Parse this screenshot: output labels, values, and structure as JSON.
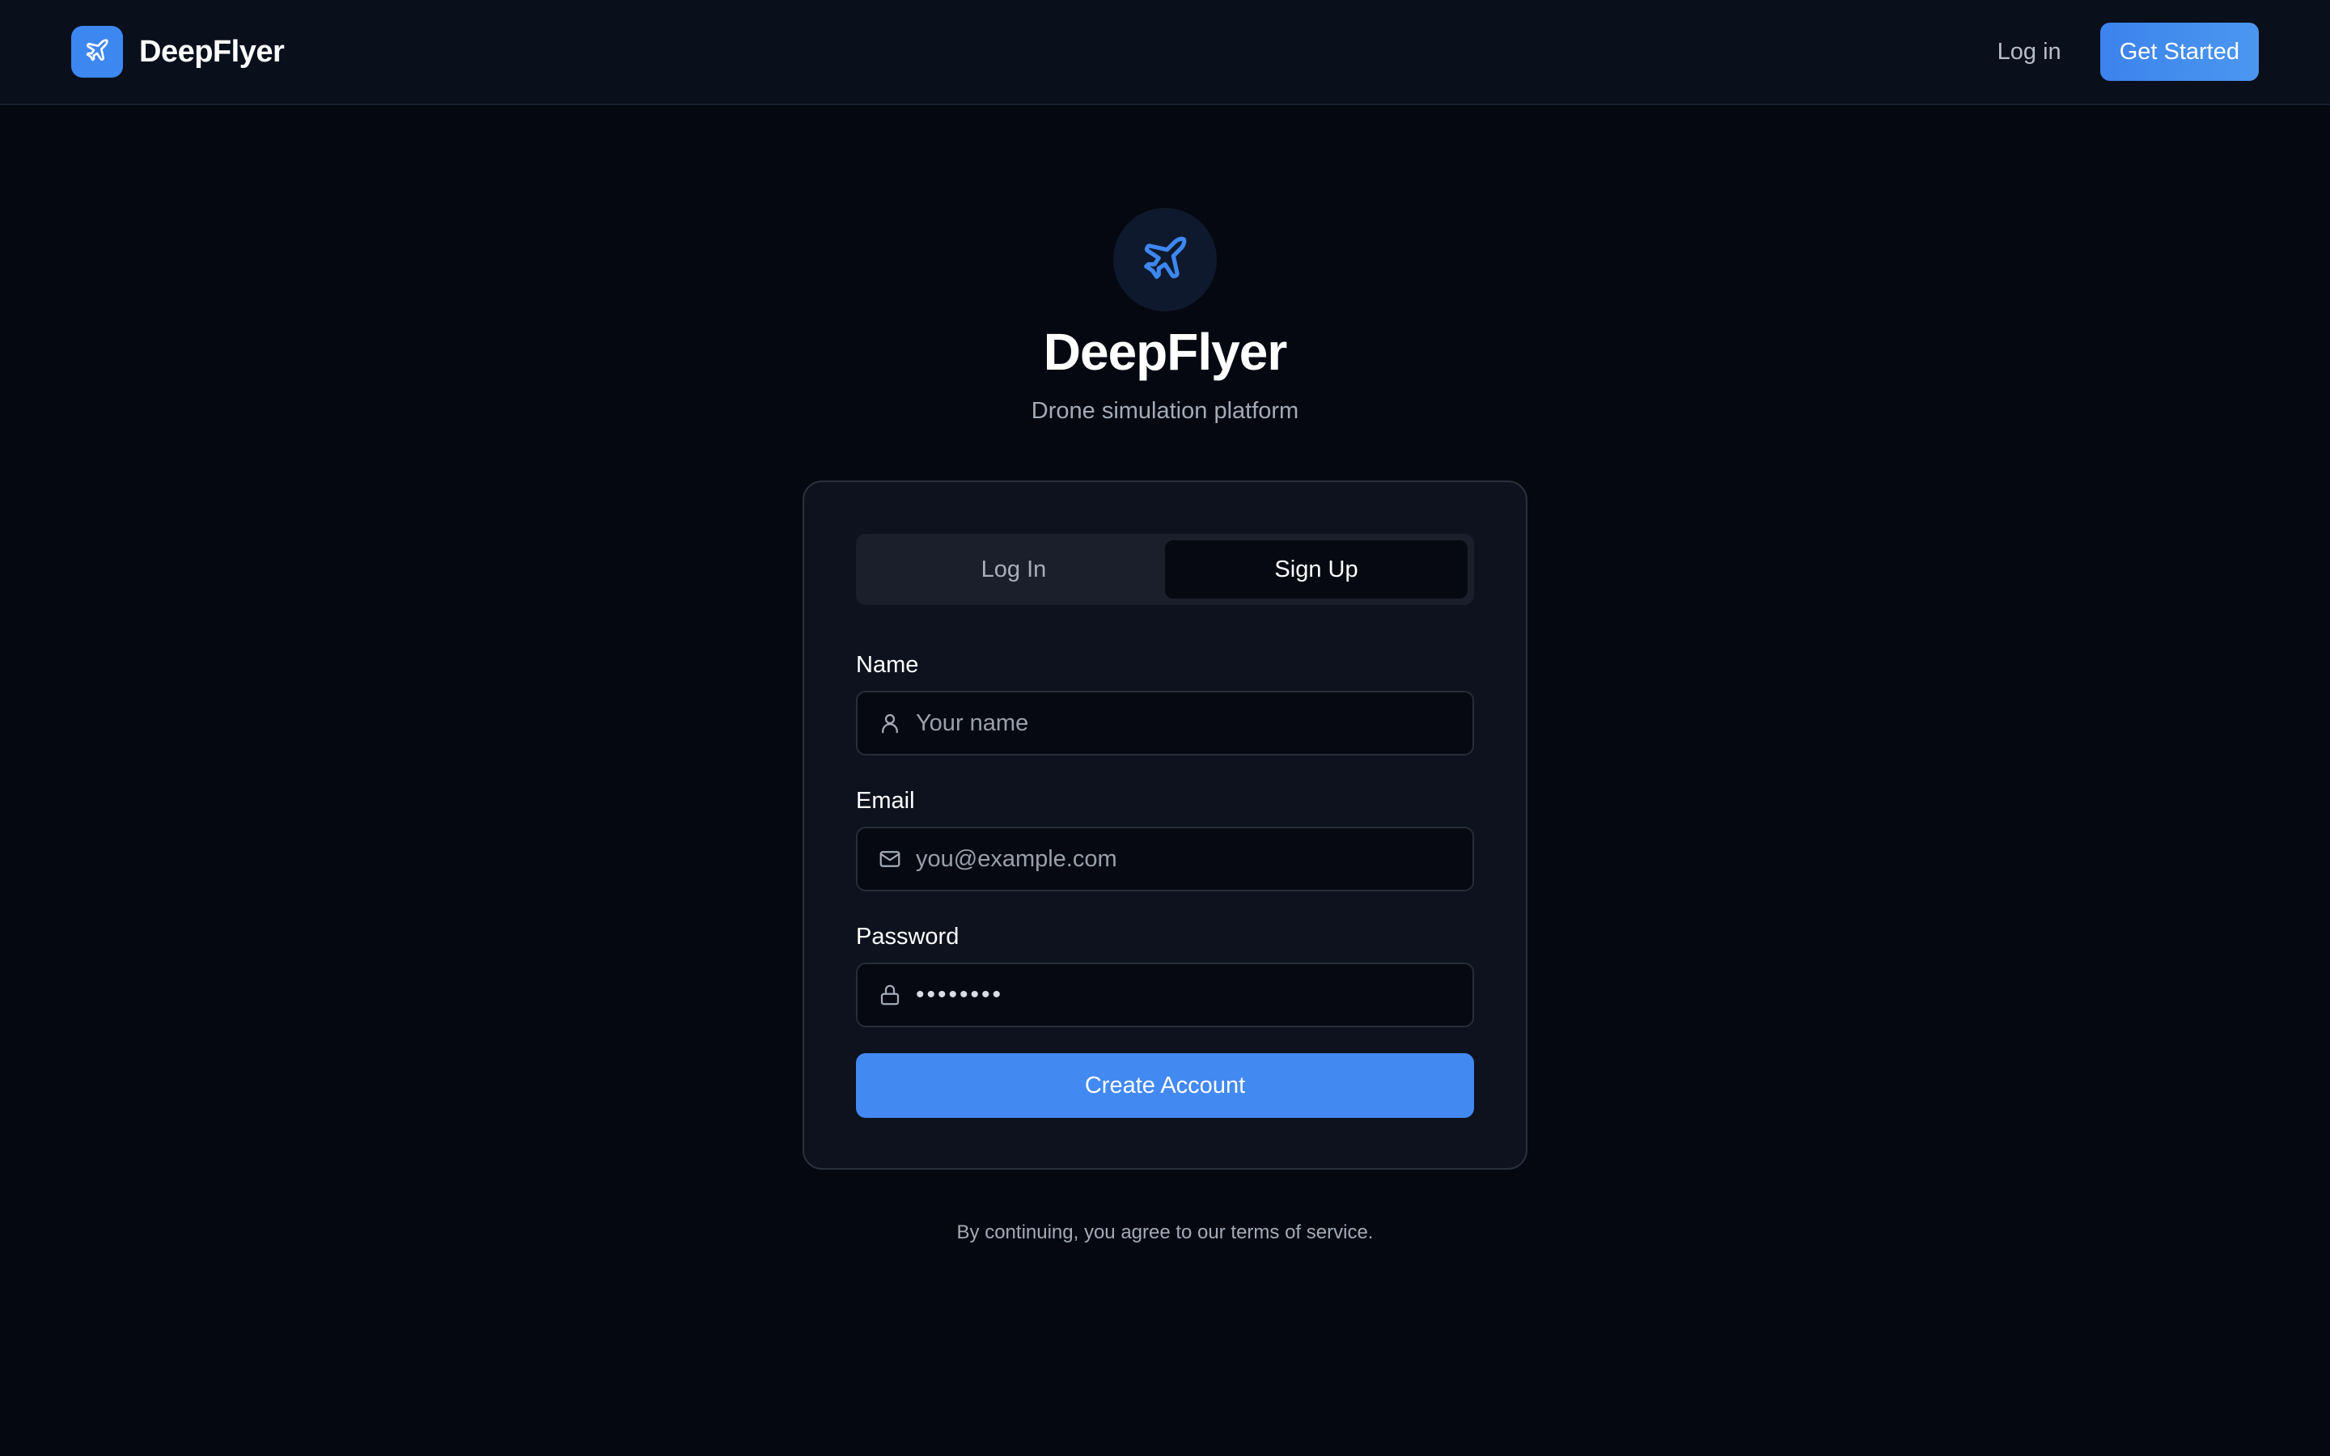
{
  "header": {
    "brand_name": "DeepFlyer",
    "brand_icon": "plane-icon",
    "login_label": "Log in",
    "cta_label": "Get Started"
  },
  "hero": {
    "icon": "plane-icon",
    "title": "DeepFlyer",
    "subtitle": "Drone simulation platform"
  },
  "auth": {
    "tabs": [
      {
        "label": "Log In",
        "active": false
      },
      {
        "label": "Sign Up",
        "active": true
      }
    ],
    "fields": {
      "name": {
        "label": "Name",
        "placeholder": "Your name",
        "value": "",
        "icon": "user-icon"
      },
      "email": {
        "label": "Email",
        "placeholder": "you@example.com",
        "value": "",
        "icon": "mail-icon"
      },
      "password": {
        "label": "Password",
        "value": "••••••••",
        "icon": "lock-icon"
      }
    },
    "submit_label": "Create Account"
  },
  "footer": {
    "terms": "By continuing, you agree to our terms of service."
  },
  "colors": {
    "background": "#050811",
    "header_bg": "#0a0f1c",
    "card_bg": "#0d121e",
    "accent": "#4289f2",
    "icon_accent": "#3d87f0"
  }
}
